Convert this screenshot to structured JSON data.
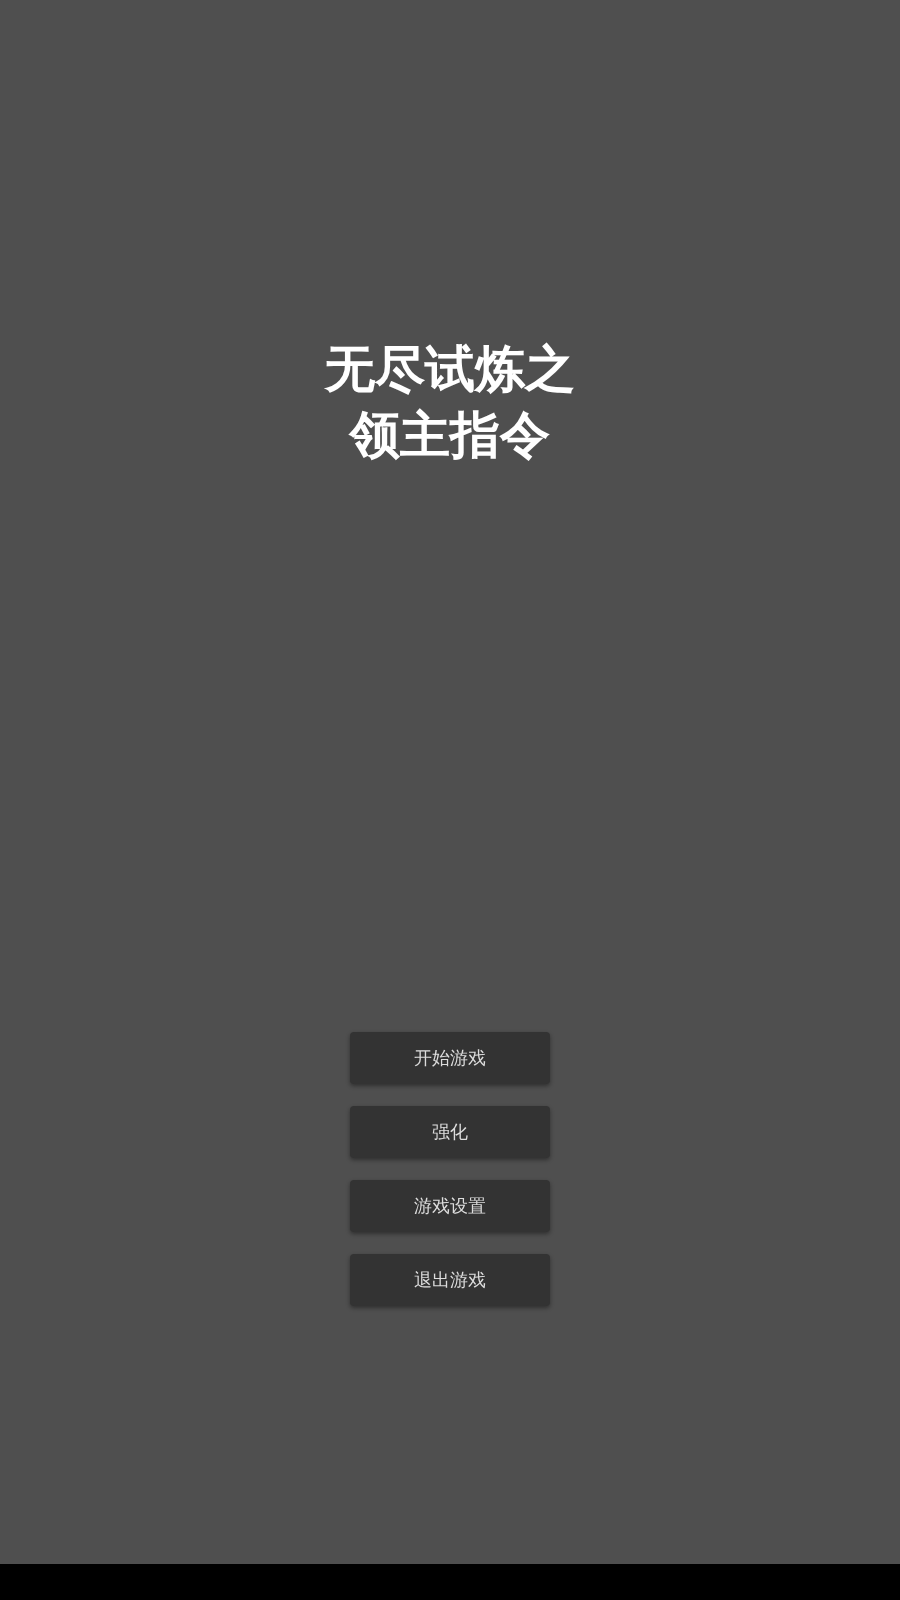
{
  "title_lines": [
    "无尽试炼之",
    "领主指令"
  ],
  "menu_buttons": [
    {
      "label": "开始游戏"
    },
    {
      "label": "强化"
    },
    {
      "label": "游戏设置"
    },
    {
      "label": "退出游戏"
    }
  ]
}
